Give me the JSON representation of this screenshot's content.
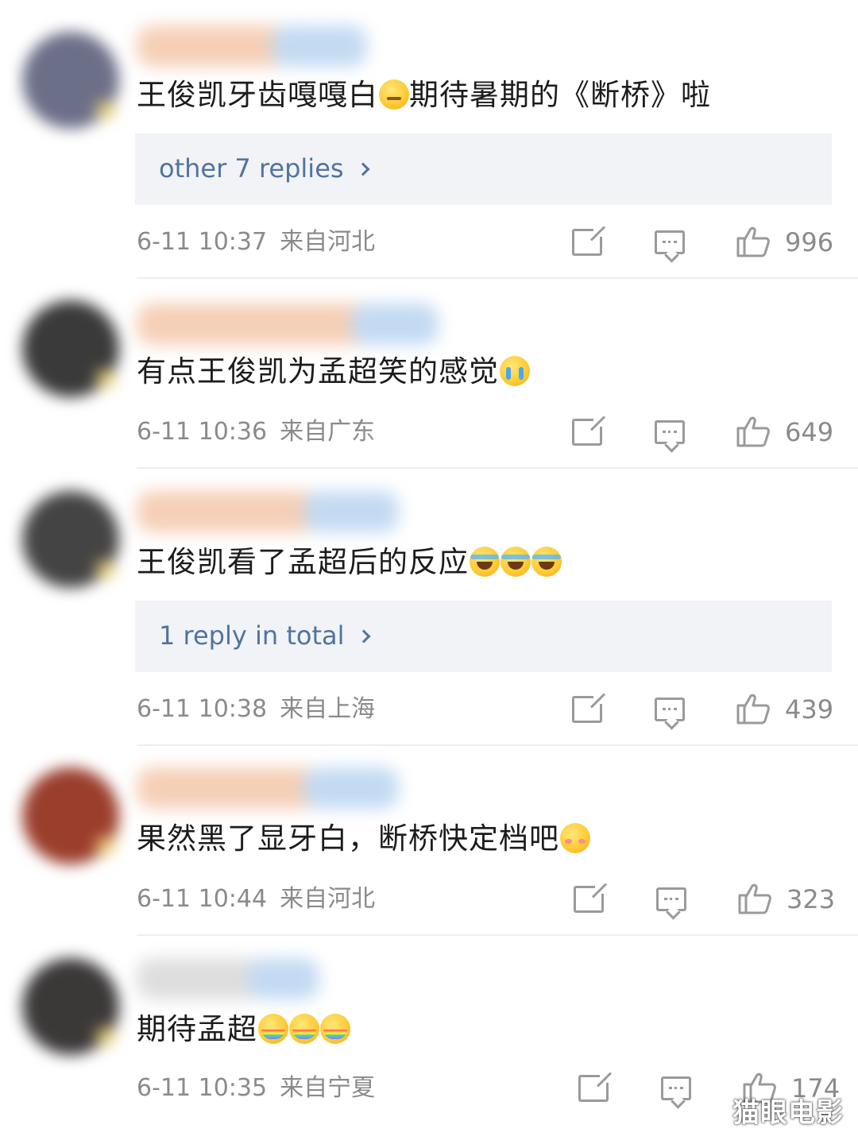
{
  "comments": [
    {
      "text": "王俊凯牙齿嘎嘎白",
      "emoji1": "thinking-emoji",
      "text2": "期待暑期的《断桥》啦",
      "replies": "other 7 replies",
      "time": "6-11 10:37",
      "location": "来自河北",
      "likes": "996",
      "avatar_color": "#6c6f88",
      "name_colors": [
        "#f4c7aa",
        "#b9d4f0"
      ]
    },
    {
      "text": "有点王俊凯为孟超笑的感觉",
      "emoji": "crying-emoji",
      "time": "6-11 10:36",
      "location": "来自广东",
      "likes": "649",
      "avatar_color": "#3a3a3a",
      "name_colors": [
        "#f4c7aa",
        "#b9d4f0"
      ]
    },
    {
      "text": "王俊凯看了孟超后的反应",
      "emoji": "laughing-emoji",
      "replies": "1 reply in total",
      "time": "6-11 10:38",
      "location": "来自上海",
      "likes": "439",
      "avatar_color": "#444444",
      "name_colors": [
        "#f4c7aa",
        "#b9d4f0"
      ]
    },
    {
      "text": "果然黑了显牙白，断桥快定档吧",
      "emoji": "shy-emoji",
      "time": "6-11 10:44",
      "location": "来自河北",
      "likes": "323",
      "avatar_color": "#9b3e2c",
      "name_colors": [
        "#f4c7aa",
        "#b9d4f0"
      ]
    },
    {
      "text": "期待孟超",
      "emoji": "rainbow-emoji",
      "time": "6-11 10:35",
      "location": "来自宁夏",
      "likes": "174",
      "avatar_color": "#3b3838",
      "name_colors": [
        "#d8d8d8",
        "#b9d4f0"
      ]
    }
  ],
  "watermark": "猫眼电影"
}
